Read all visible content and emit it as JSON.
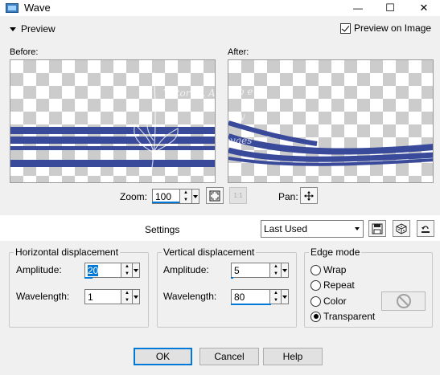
{
  "window": {
    "title": "Wave",
    "minimize_glyph": "—",
    "maximize_glyph": "☐",
    "close_glyph": "✕"
  },
  "preview": {
    "toggle_label": "Preview",
    "preview_on_image_label": "Preview on Image",
    "preview_on_image_checked": true,
    "before_label": "Before:",
    "after_label": "After:",
    "watermark_lines": [
      "Tutorial, Apo e",
      "Formatação by",
      "Neusa Novaes"
    ]
  },
  "zoom": {
    "label": "Zoom:",
    "value": "100",
    "pan_label": "Pan:",
    "fit_icon": "fit-window-icon",
    "actual_size_icon": "actual-size-icon",
    "actual_size_text": "1:1",
    "pan_icon": "move-arrows-icon"
  },
  "settings": {
    "label": "Settings",
    "preset_value": "Last Used",
    "save_icon": "save-preset-icon",
    "randomize_icon": "dice-icon",
    "reset_icon": "reset-icon"
  },
  "horizontal": {
    "title": "Horizontal displacement",
    "amplitude_label": "Amplitude:",
    "amplitude_value": "20",
    "wavelength_label": "Wavelength:",
    "wavelength_value": "1"
  },
  "vertical": {
    "title": "Vertical displacement",
    "amplitude_label": "Amplitude:",
    "amplitude_value": "5",
    "wavelength_label": "Wavelength:",
    "wavelength_value": "80"
  },
  "edge_mode": {
    "title": "Edge mode",
    "options": [
      "Wrap",
      "Repeat",
      "Color",
      "Transparent"
    ],
    "selected": "Transparent",
    "color_swatch_icon": "no-color-icon"
  },
  "buttons": {
    "ok": "OK",
    "cancel": "Cancel",
    "help": "Help"
  },
  "colors": {
    "accent": "#0078d7",
    "stripe": "#3a4a9a"
  }
}
